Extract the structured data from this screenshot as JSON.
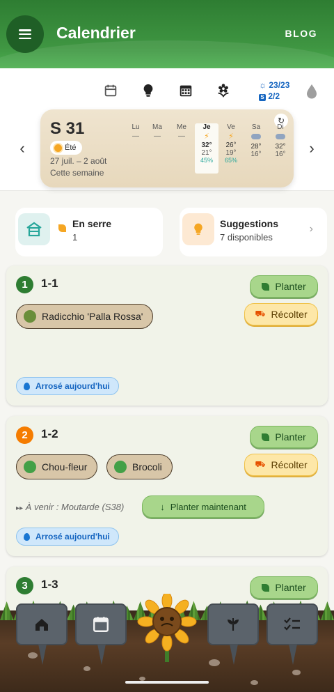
{
  "header": {
    "title": "Calendrier",
    "blog_label": "BLOG"
  },
  "toolbar": {
    "icons": [
      "calendar-outline-icon",
      "lightbulb-icon",
      "calendar-grid-icon",
      "flower-icon",
      "drop-icon"
    ],
    "sun_stat": "23/23",
    "count_stat": "2/2"
  },
  "week": {
    "number": "S 31",
    "season": "Été",
    "range": "27 juil. – 2 août",
    "label": "Cette semaine",
    "days": [
      {
        "name": "Lu",
        "weather": "",
        "high": "—",
        "low": "",
        "humidity": ""
      },
      {
        "name": "Ma",
        "weather": "",
        "high": "—",
        "low": "",
        "humidity": ""
      },
      {
        "name": "Me",
        "weather": "",
        "high": "—",
        "low": "",
        "humidity": ""
      },
      {
        "name": "Je",
        "weather": "⚡",
        "high": "32°",
        "low": "21°",
        "humidity": "45%"
      },
      {
        "name": "Ve",
        "weather": "⚡",
        "high": "26°",
        "low": "19°",
        "humidity": "65%"
      },
      {
        "name": "Sa",
        "weather": "cloud",
        "high": "28°",
        "low": "16°",
        "humidity": ""
      },
      {
        "name": "Di",
        "weather": "cloud",
        "high": "32°",
        "low": "16°",
        "humidity": ""
      }
    ]
  },
  "summary": {
    "greenhouse": {
      "title": "En serre",
      "count": "1"
    },
    "suggestions": {
      "title": "Suggestions",
      "sub": "7 disponibles"
    }
  },
  "beds": [
    {
      "badge": "1",
      "name": "1-1",
      "badge_color": "#2e7d32",
      "plant_label": "Planter",
      "harvest_label": "Récolter",
      "crops": [
        "Radicchio 'Palla Rossa'"
      ],
      "watered": "Arrosé aujourd'hui"
    },
    {
      "badge": "2",
      "name": "1-2",
      "badge_color": "#f57c00",
      "plant_label": "Planter",
      "harvest_label": "Récolter",
      "crops": [
        "Chou-fleur",
        "Brocoli"
      ],
      "upcoming": "À venir : Moutarde (S38)",
      "plant_now": "Planter maintenant",
      "watered": "Arrosé aujourd'hui"
    },
    {
      "badge": "3",
      "name": "1-3",
      "badge_color": "#2e7d32",
      "plant_label": "Planter"
    }
  ],
  "bottom_nav": [
    "home-icon",
    "calendar-icon",
    "sunflower-mascot",
    "sprout-icon",
    "checklist-icon"
  ]
}
